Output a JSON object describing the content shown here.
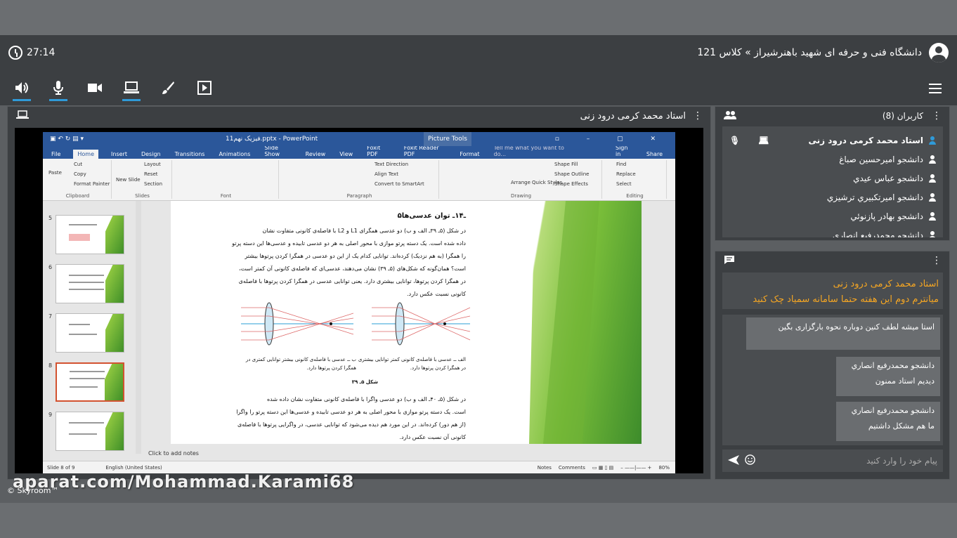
{
  "header": {
    "timer": "27:14",
    "room_title": "دانشگاه فنی و حرفه ای شهید باهنرشیراز » کلاس 121"
  },
  "main": {
    "presenter": "استاد محمد کرمی درود زنی"
  },
  "ppt": {
    "file_title": "فیزیک نهم11.pptx - PowerPoint",
    "picture_tools": "Picture Tools",
    "tabs": [
      "File",
      "Home",
      "Insert",
      "Design",
      "Transitions",
      "Animations",
      "Slide Show",
      "Review",
      "View",
      "Foxit PDF",
      "Foxit Reader PDF",
      "Format"
    ],
    "tell_me": "Tell me what you want to do...",
    "sign_in": "Sign in",
    "share": "Share",
    "groups": {
      "clipboard": "Clipboard",
      "slides": "Slides",
      "font": "Font",
      "paragraph": "Paragraph",
      "drawing": "Drawing",
      "editing": "Editing"
    },
    "clipboard_items": {
      "paste": "Paste",
      "cut": "Cut",
      "copy": "Copy",
      "format_painter": "Format Painter"
    },
    "slides_items": {
      "new_slide": "New Slide",
      "layout": "Layout",
      "reset": "Reset",
      "section": "Section"
    },
    "paragraph_items": {
      "text_direction": "Text Direction",
      "align_text": "Align Text",
      "convert": "Convert to SmartArt"
    },
    "drawing_items": {
      "arrange": "Arrange",
      "quick_styles": "Quick Styles",
      "shape_fill": "Shape Fill",
      "shape_outline": "Shape Outline",
      "shape_effects": "Shape Effects"
    },
    "editing_items": {
      "find": "Find",
      "replace": "Replace",
      "select": "Select"
    },
    "thumbs": [
      "5",
      "6",
      "7",
      "8",
      "9"
    ],
    "slide": {
      "heading": "۵ـ۱۴ـ توان عدسی‌ها",
      "lines": [
        "در شکل (۵ـ ۳۹ـ الف و ب) دو عدسی همگرای L1 و L2 با فاصله‌ی کانونی متفاوت نشان",
        "داده شده است. یک دسته پرتو موازی با محور اصلی به هر دو عدسی تابیده و عدسی‌ها این دسته پرتو",
        "را همگرا (به هم نزدیک) کرده‌اند. توانایی کدام یک از این دو عدسی در همگرا کردن پرتوها بیشتر",
        "است؟ همان‌گونه که شکل‌های (۵ـ ۳۹) نشان می‌دهند، عدسی‌ای که فاصله‌ی کانونی آن کمتر است،",
        "در همگرا کردن پرتوها، توانایی بیشتری دارد. یعنی توانایی عدسی در همگرا کردن پرتوها با فاصله‌ی",
        "کانونی نسبت عکس دارد."
      ],
      "cap_a": "الف ــ عدسی با فاصله‌ی کانونی کمتر توانایی بیشتری",
      "cap_a2": "در همگرا کردن پرتوها دارد.",
      "cap_b": "ب ــ عدسی با فاصله‌ی کانونی بیشتر توانایی کمتری در",
      "cap_b2": "همگرا کردن پرتوها دارد.",
      "fig": "شکل ۵ـ ۳۹",
      "lines2": [
        "در شکل (۵ـ ۴۰ـ الف و ب) دو عدسی واگرا با فاصله‌ی کانونی متفاوت نشان داده شده",
        "است. یک دسته پرتو موازی با محور اصلی به هر دو عدسی تابیده و عدسی‌ها این دسته پرتو را واگرا",
        "(از هم دور) کرده‌اند. در این مورد هم دیده می‌شود که توانایی عدسی، در واگرایی پرتوها با فاصله‌ی",
        "کانونی آن نسبت عکس دارد."
      ]
    },
    "notes": "Click to add notes",
    "status": {
      "slide": "Slide 8 of 9",
      "lang": "English (United States)",
      "notes": "Notes",
      "comments": "Comments",
      "zoom": "80%"
    }
  },
  "users": {
    "title": "کاربران (8)",
    "list": [
      "استاد محمد کرمی درود زنی",
      "دانشجو امیرحسین صباغ",
      "دانشجو عباس عیدي",
      "دانشجو امیرتکبیري ترشیزي",
      "دانشجو بهادر پازنوئي",
      "دانشجو محمدرفیع انصاري"
    ]
  },
  "chat": {
    "notice_sender": "استاد محمد کرمی درود زنی",
    "notice_text": "میانترم دوم این هفته حتما سامانه سمیاد چک کنید",
    "m1_text": "استا میشه لطف کنین دوباره نحوه بارگزاری بگین",
    "m2_sender": "دانشجو محمدرفیع انصاري",
    "m2_text": "دیدیم استاد ممنون",
    "m3_sender": "دانشجو محمدرفیع انصاري",
    "m3_text": "ما هم مشکل داشتیم",
    "placeholder": "پیام خود را وارد کنید"
  },
  "watermark": "aparat.com/Mohammad.Karami68",
  "brand": "© Skyroom™"
}
